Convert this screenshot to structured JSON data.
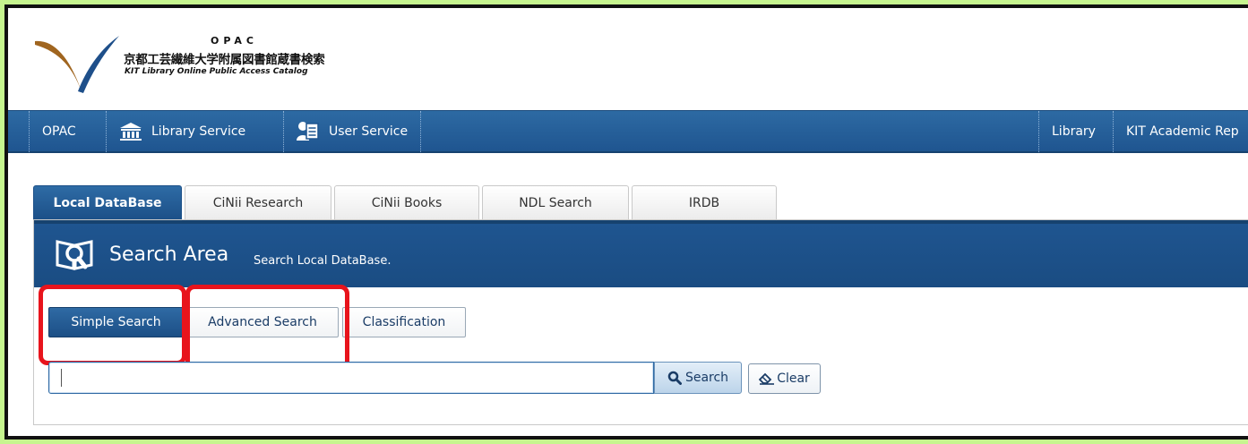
{
  "logo": {
    "opac": "OPAC",
    "title_jp": "京都工芸繊維大学附属図書館蔵書検索",
    "title_en": "KIT Library Online Public Access Catalog"
  },
  "nav": {
    "left": [
      {
        "label": "OPAC",
        "icon": ""
      },
      {
        "label": "Library Service",
        "icon": "library-building-icon"
      },
      {
        "label": "User Service",
        "icon": "user-notepad-icon"
      }
    ],
    "right": [
      {
        "label": "Library"
      },
      {
        "label": "KIT Academic Rep"
      }
    ]
  },
  "tabs": [
    {
      "label": "Local DataBase",
      "active": true
    },
    {
      "label": "CiNii Research",
      "active": false
    },
    {
      "label": "CiNii Books",
      "active": false
    },
    {
      "label": "NDL Search",
      "active": false
    },
    {
      "label": "IRDB",
      "active": false
    }
  ],
  "search_area": {
    "icon": "magnifier-book-icon",
    "title": "Search Area",
    "subtitle": "Search Local DataBase."
  },
  "modes": [
    {
      "label": "Simple Search",
      "active": true
    },
    {
      "label": "Advanced Search",
      "active": false
    },
    {
      "label": "Classification",
      "active": false
    }
  ],
  "search": {
    "value": "",
    "button_label": "Search",
    "button_icon": "search-icon",
    "clear_label": "Clear",
    "clear_icon": "eraser-icon"
  },
  "colors": {
    "nav_blue": "#1f5590",
    "highlight_red": "#e8141c",
    "page_background": "#c6f58f"
  }
}
